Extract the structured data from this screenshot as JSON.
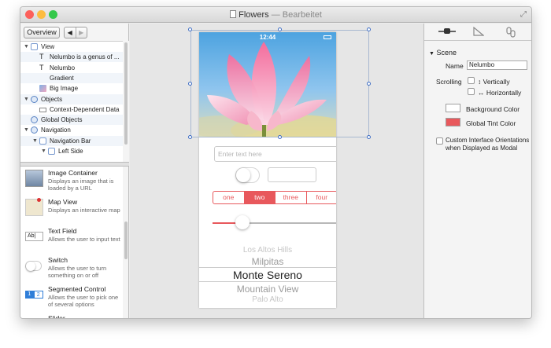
{
  "window": {
    "title": "Flowers",
    "subtitle": "—  Bearbeitet",
    "traffic_colors": [
      "#fc605b",
      "#fdbc40",
      "#34c84a"
    ]
  },
  "left_panel": {
    "overview_label": "Overview",
    "back_glyph": "◀",
    "forward_glyph": "▶",
    "outline": [
      {
        "label": "View",
        "icon": "view-icon",
        "indent": 0,
        "expanded": true
      },
      {
        "label": "Nelumbo is a genus of ...",
        "icon": "text-icon",
        "indent": 1
      },
      {
        "label": "Nelumbo",
        "icon": "text-icon",
        "indent": 1
      },
      {
        "label": "Gradient",
        "icon": "gradient-icon",
        "indent": 1
      },
      {
        "label": "Big Image",
        "icon": "image-icon",
        "indent": 1
      },
      {
        "label": "Objects",
        "icon": "objects-icon",
        "indent": 0,
        "expanded": true
      },
      {
        "label": "Context-Dependent Data",
        "icon": "data-icon",
        "indent": 1
      },
      {
        "label": "Global Objects",
        "icon": "global-icon",
        "indent": 0
      },
      {
        "label": "Navigation",
        "icon": "navigation-icon",
        "indent": 0,
        "expanded": true
      },
      {
        "label": "Navigation Bar",
        "icon": "navbar-icon",
        "indent": 1,
        "expanded": true
      },
      {
        "label": "Left Side",
        "icon": "view-icon",
        "indent": 2,
        "expanded": true
      }
    ],
    "library": [
      {
        "title": "Image Container",
        "desc": "Displays an image that is loaded by a URL",
        "thumb": "image-container-thumb"
      },
      {
        "title": "Map View",
        "desc": "Displays an interactive map",
        "thumb": "map-thumb"
      },
      {
        "title": "Text Field",
        "desc": "Allows the user to input text",
        "thumb": "text-field-thumb",
        "thumb_text": "Ab|"
      },
      {
        "title": "Switch",
        "desc": "Allows the user to turn something on or off",
        "thumb": "switch-thumb"
      },
      {
        "title": "Segmented Control",
        "desc": "Allows the user to pick one of several options",
        "thumb": "segmented-thumb",
        "thumb_text": [
          "1",
          "2"
        ]
      },
      {
        "title": "Slider",
        "desc": "",
        "thumb": "slider-thumb"
      }
    ]
  },
  "canvas": {
    "status_time": "12:44",
    "text_field_placeholder": "Enter text here",
    "segments": [
      "one",
      "two",
      "three",
      "four"
    ],
    "selected_segment": 1,
    "slider_value_fraction": 0.24,
    "picker_items": [
      "Los Altos Hills",
      "Milpitas",
      "Monte Sereno",
      "Mountain View",
      "Palo Alto"
    ],
    "picker_selected": 2,
    "accent_color": "#e8585c"
  },
  "inspector": {
    "tab_icons": [
      "attributes-icon",
      "ruler-icon",
      "link-icon"
    ],
    "section_title": "Scene",
    "name_label": "Name",
    "name_value": "Nelumbo",
    "scrolling_label": "Scrolling",
    "vertically_label": "Vertically",
    "horizontally_label": "Horizontally",
    "bg_color_label": "Background Color",
    "bg_color_value": "#ffffff",
    "tint_color_label": "Global Tint Color",
    "tint_color_value": "#e8585c",
    "orientation_label": "Custom Interface Orientations when Displayed as Modal"
  }
}
